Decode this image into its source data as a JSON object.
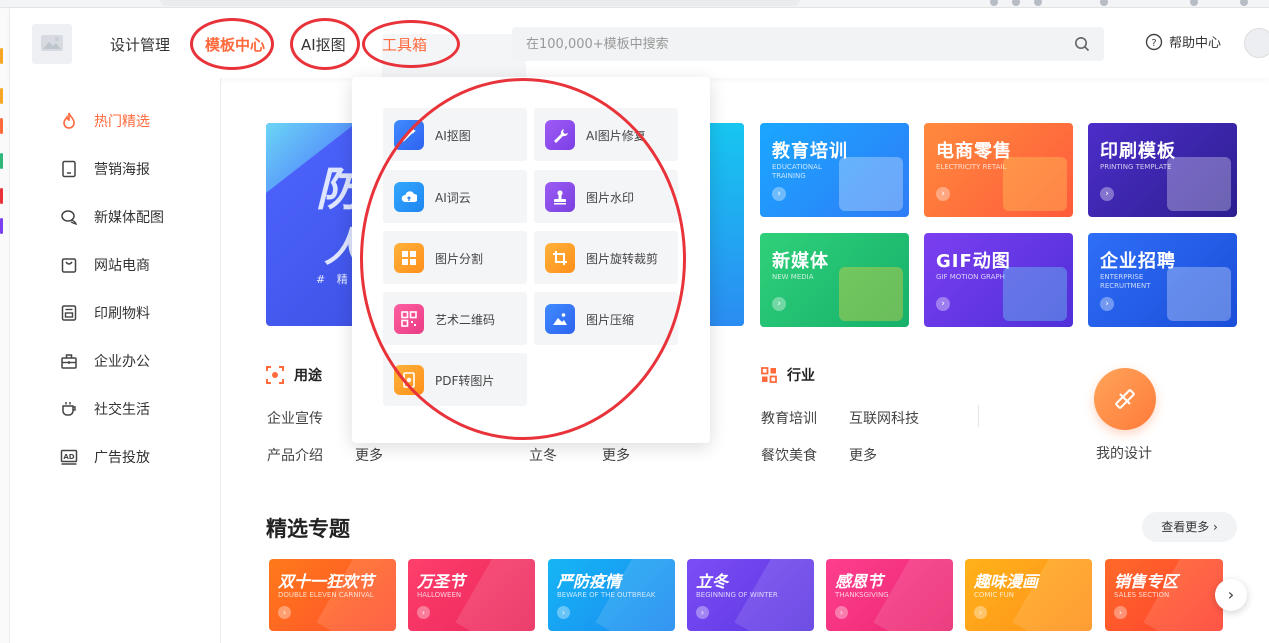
{
  "colors": {
    "accent": "#ff6a3d",
    "annotation": "#e8333a"
  },
  "header": {
    "nav": [
      "设计管理",
      "模板中心",
      "AI抠图",
      "工具箱"
    ],
    "active_nav": "模板中心",
    "search_placeholder": "在100,000+模板中搜索",
    "help_label": "帮助中心"
  },
  "sidebar": {
    "items": [
      {
        "label": "热门精选",
        "icon": "flame-icon",
        "active": true
      },
      {
        "label": "营销海报",
        "icon": "tablet-icon"
      },
      {
        "label": "新媒体配图",
        "icon": "chat-bubbles-icon"
      },
      {
        "label": "网站电商",
        "icon": "bag-icon"
      },
      {
        "label": "印刷物料",
        "icon": "printer-icon"
      },
      {
        "label": "企业办公",
        "icon": "briefcase-icon"
      },
      {
        "label": "社交生活",
        "icon": "cup-icon"
      },
      {
        "label": "广告投放",
        "icon": "ad-icon"
      }
    ]
  },
  "banner": {
    "big1": "防",
    "big2": "人",
    "small": "# 精 选"
  },
  "categories": [
    {
      "title": "教育培训",
      "en": "EDUCATIONAL TRAINING",
      "color1": "#1aa7ff",
      "color2": "#2f7cf6"
    },
    {
      "title": "电商零售",
      "en": "ELECTRICITY RETAIL",
      "color1": "#ff8a3d",
      "color2": "#ff5b3b"
    },
    {
      "title": "印刷模板",
      "en": "PRINTING TEMPLATE",
      "color1": "#4d2dc9",
      "color2": "#2c1f8f"
    },
    {
      "title": "新媒体",
      "en": "NEW MEDIA",
      "color1": "#2fd07a",
      "color2": "#16b06a"
    },
    {
      "title": "GIF动图",
      "en": "GIF MOTION GRAPH",
      "color1": "#7b3ff0",
      "color2": "#4f2fd8"
    },
    {
      "title": "企业招聘",
      "en": "ENTERPRISE RECRUITMENT",
      "color1": "#2f6ef7",
      "color2": "#1a4ed8"
    }
  ],
  "usage": {
    "title": "用途",
    "links": [
      "企业宣传",
      "产品介绍",
      "更多"
    ]
  },
  "festival": {
    "links": [
      "立冬",
      "更多"
    ]
  },
  "industry": {
    "title": "行业",
    "links": [
      "教育培训",
      "互联网科技",
      "餐饮美食",
      "更多"
    ]
  },
  "my_design_label": "我的设计",
  "featured": {
    "title": "精选专题",
    "more_label": "查看更多 ›",
    "topics": [
      {
        "title": "双十一狂欢节",
        "en": "DOUBLE ELEVEN CARNIVAL",
        "color1": "#ff7a1a",
        "color2": "#ff4d2e"
      },
      {
        "title": "万圣节",
        "en": "HALLOWEEN",
        "color1": "#ff3f6c",
        "color2": "#e8245a"
      },
      {
        "title": "严防疫情",
        "en": "BEWARE OF THE OUTBREAK",
        "color1": "#16b6f5",
        "color2": "#1a86f0"
      },
      {
        "title": "立冬",
        "en": "BEGINNING OF WINTER",
        "color1": "#7c4df5",
        "color2": "#5a35e0"
      },
      {
        "title": "感恩节",
        "en": "THANKSGIVING",
        "color1": "#ff3f8e",
        "color2": "#e8246e"
      },
      {
        "title": "趣味漫画",
        "en": "COMIC FUN",
        "color1": "#ffb21a",
        "color2": "#ff8f1a"
      },
      {
        "title": "销售专区",
        "en": "SALES SECTION",
        "color1": "#ff6a2a",
        "color2": "#ff3d2e"
      }
    ]
  },
  "toolbox": {
    "tools": [
      {
        "label": "AI抠图",
        "icon": "magic-wand-icon",
        "color1": "#3f8cff",
        "color2": "#2f62f0"
      },
      {
        "label": "AI图片修复",
        "icon": "wrench-icon",
        "color1": "#a05bf5",
        "color2": "#7b3fe6"
      },
      {
        "label": "AI词云",
        "icon": "cloud-icon",
        "color1": "#33a7ff",
        "color2": "#1f86f0"
      },
      {
        "label": "图片水印",
        "icon": "stamp-icon",
        "color1": "#9b5cf3",
        "color2": "#7a40e0"
      },
      {
        "label": "图片分割",
        "icon": "grid-icon",
        "color1": "#ffb23a",
        "color2": "#ff8f1a"
      },
      {
        "label": "图片旋转裁剪",
        "icon": "crop-rotate-icon",
        "color1": "#ffb23a",
        "color2": "#ff8f1a"
      },
      {
        "label": "艺术二维码",
        "icon": "qrcode-icon",
        "color1": "#ff5fa0",
        "color2": "#ea3c86"
      },
      {
        "label": "图片压缩",
        "icon": "image-icon",
        "color1": "#3f8cff",
        "color2": "#2f62f0"
      },
      {
        "label": "PDF转图片",
        "icon": "pdf-icon",
        "color1": "#ffb23a",
        "color2": "#ff8f1a"
      }
    ]
  }
}
